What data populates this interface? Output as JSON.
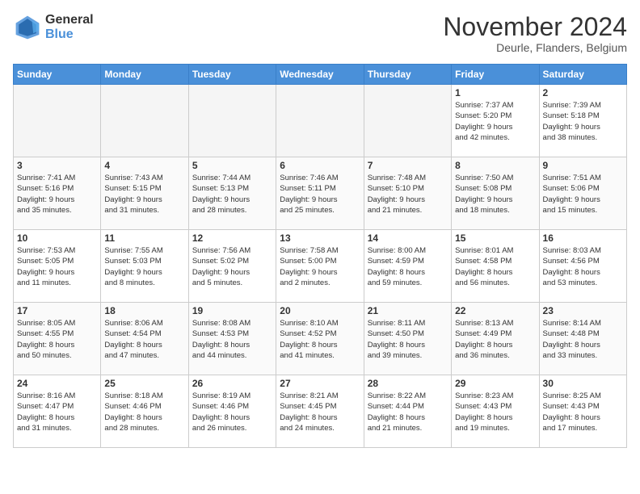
{
  "logo": {
    "general": "General",
    "blue": "Blue"
  },
  "title": "November 2024",
  "location": "Deurle, Flanders, Belgium",
  "days_of_week": [
    "Sunday",
    "Monday",
    "Tuesday",
    "Wednesday",
    "Thursday",
    "Friday",
    "Saturday"
  ],
  "weeks": [
    [
      {
        "day": "",
        "info": ""
      },
      {
        "day": "",
        "info": ""
      },
      {
        "day": "",
        "info": ""
      },
      {
        "day": "",
        "info": ""
      },
      {
        "day": "",
        "info": ""
      },
      {
        "day": "1",
        "info": "Sunrise: 7:37 AM\nSunset: 5:20 PM\nDaylight: 9 hours\nand 42 minutes."
      },
      {
        "day": "2",
        "info": "Sunrise: 7:39 AM\nSunset: 5:18 PM\nDaylight: 9 hours\nand 38 minutes."
      }
    ],
    [
      {
        "day": "3",
        "info": "Sunrise: 7:41 AM\nSunset: 5:16 PM\nDaylight: 9 hours\nand 35 minutes."
      },
      {
        "day": "4",
        "info": "Sunrise: 7:43 AM\nSunset: 5:15 PM\nDaylight: 9 hours\nand 31 minutes."
      },
      {
        "day": "5",
        "info": "Sunrise: 7:44 AM\nSunset: 5:13 PM\nDaylight: 9 hours\nand 28 minutes."
      },
      {
        "day": "6",
        "info": "Sunrise: 7:46 AM\nSunset: 5:11 PM\nDaylight: 9 hours\nand 25 minutes."
      },
      {
        "day": "7",
        "info": "Sunrise: 7:48 AM\nSunset: 5:10 PM\nDaylight: 9 hours\nand 21 minutes."
      },
      {
        "day": "8",
        "info": "Sunrise: 7:50 AM\nSunset: 5:08 PM\nDaylight: 9 hours\nand 18 minutes."
      },
      {
        "day": "9",
        "info": "Sunrise: 7:51 AM\nSunset: 5:06 PM\nDaylight: 9 hours\nand 15 minutes."
      }
    ],
    [
      {
        "day": "10",
        "info": "Sunrise: 7:53 AM\nSunset: 5:05 PM\nDaylight: 9 hours\nand 11 minutes."
      },
      {
        "day": "11",
        "info": "Sunrise: 7:55 AM\nSunset: 5:03 PM\nDaylight: 9 hours\nand 8 minutes."
      },
      {
        "day": "12",
        "info": "Sunrise: 7:56 AM\nSunset: 5:02 PM\nDaylight: 9 hours\nand 5 minutes."
      },
      {
        "day": "13",
        "info": "Sunrise: 7:58 AM\nSunset: 5:00 PM\nDaylight: 9 hours\nand 2 minutes."
      },
      {
        "day": "14",
        "info": "Sunrise: 8:00 AM\nSunset: 4:59 PM\nDaylight: 8 hours\nand 59 minutes."
      },
      {
        "day": "15",
        "info": "Sunrise: 8:01 AM\nSunset: 4:58 PM\nDaylight: 8 hours\nand 56 minutes."
      },
      {
        "day": "16",
        "info": "Sunrise: 8:03 AM\nSunset: 4:56 PM\nDaylight: 8 hours\nand 53 minutes."
      }
    ],
    [
      {
        "day": "17",
        "info": "Sunrise: 8:05 AM\nSunset: 4:55 PM\nDaylight: 8 hours\nand 50 minutes."
      },
      {
        "day": "18",
        "info": "Sunrise: 8:06 AM\nSunset: 4:54 PM\nDaylight: 8 hours\nand 47 minutes."
      },
      {
        "day": "19",
        "info": "Sunrise: 8:08 AM\nSunset: 4:53 PM\nDaylight: 8 hours\nand 44 minutes."
      },
      {
        "day": "20",
        "info": "Sunrise: 8:10 AM\nSunset: 4:52 PM\nDaylight: 8 hours\nand 41 minutes."
      },
      {
        "day": "21",
        "info": "Sunrise: 8:11 AM\nSunset: 4:50 PM\nDaylight: 8 hours\nand 39 minutes."
      },
      {
        "day": "22",
        "info": "Sunrise: 8:13 AM\nSunset: 4:49 PM\nDaylight: 8 hours\nand 36 minutes."
      },
      {
        "day": "23",
        "info": "Sunrise: 8:14 AM\nSunset: 4:48 PM\nDaylight: 8 hours\nand 33 minutes."
      }
    ],
    [
      {
        "day": "24",
        "info": "Sunrise: 8:16 AM\nSunset: 4:47 PM\nDaylight: 8 hours\nand 31 minutes."
      },
      {
        "day": "25",
        "info": "Sunrise: 8:18 AM\nSunset: 4:46 PM\nDaylight: 8 hours\nand 28 minutes."
      },
      {
        "day": "26",
        "info": "Sunrise: 8:19 AM\nSunset: 4:46 PM\nDaylight: 8 hours\nand 26 minutes."
      },
      {
        "day": "27",
        "info": "Sunrise: 8:21 AM\nSunset: 4:45 PM\nDaylight: 8 hours\nand 24 minutes."
      },
      {
        "day": "28",
        "info": "Sunrise: 8:22 AM\nSunset: 4:44 PM\nDaylight: 8 hours\nand 21 minutes."
      },
      {
        "day": "29",
        "info": "Sunrise: 8:23 AM\nSunset: 4:43 PM\nDaylight: 8 hours\nand 19 minutes."
      },
      {
        "day": "30",
        "info": "Sunrise: 8:25 AM\nSunset: 4:43 PM\nDaylight: 8 hours\nand 17 minutes."
      }
    ]
  ]
}
